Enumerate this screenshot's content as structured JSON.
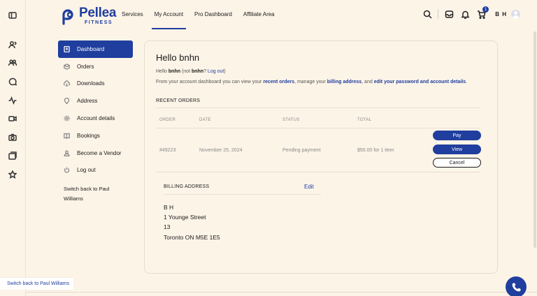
{
  "brand": {
    "name": "Pellea",
    "sub": "FITNESS",
    "color": "#1f3e9e"
  },
  "nav": {
    "services": "Services",
    "my_account": "My Account",
    "pro_dashboard": "Pro Dashboard",
    "affiliate": "Affiliate Area"
  },
  "header": {
    "cart_count": "1",
    "user_initials": "B H"
  },
  "rail_icons": [
    "sidebar-toggle-icon",
    "user-switch-icon",
    "group-icon",
    "chat-icon",
    "activity-icon",
    "video-icon",
    "camera-icon",
    "layers-icon",
    "star-icon"
  ],
  "menu": {
    "items": [
      {
        "label": "Dashboard",
        "icon": "dashboard-icon"
      },
      {
        "label": "Orders",
        "icon": "box-icon"
      },
      {
        "label": "Downloads",
        "icon": "cloud-download-icon"
      },
      {
        "label": "Address",
        "icon": "location-icon"
      },
      {
        "label": "Account details",
        "icon": "gear-icon"
      },
      {
        "label": "Bookings",
        "icon": "book-icon"
      },
      {
        "label": "Become a Vendor",
        "icon": "user-icon"
      },
      {
        "label": "Log out",
        "icon": "power-icon"
      }
    ],
    "switch_back": "Switch back to Paul Williams"
  },
  "main": {
    "title": "Hello bnhn",
    "hello_prefix": "Hello ",
    "hello_name": "bnhn",
    "hello_mid": " (not ",
    "hello_name2": "bnhn",
    "hello_q": "? ",
    "logout_link": "Log out",
    "hello_end": ")",
    "intro_1": "From your account dashboard you can view your ",
    "intro_link1": "recent orders",
    "intro_2": ", manage your ",
    "intro_link2": "billing address",
    "intro_3": ", and ",
    "intro_link3": "edit your password and account details",
    "intro_4": "."
  },
  "recent_orders": {
    "title": "RECENT ORDERS",
    "columns": [
      "ORDER",
      "DATE",
      "STATUS",
      "TOTAL"
    ],
    "row": {
      "order": "#49223",
      "date": "November 25, 2024",
      "status": "Pending payment",
      "total": "$50.00 for 1 item"
    },
    "actions": {
      "pay": "Pay",
      "view": "View",
      "cancel": "Cancel"
    }
  },
  "billing": {
    "title": "BILLING ADDRESS",
    "edit": "Edit",
    "lines": [
      "B H",
      "1 Younge Street",
      "13",
      "Toronto ON M5E 1E5"
    ]
  },
  "floating": {
    "switch_back": "Switch back to Paul Williams",
    "phone_icon": "phone-icon"
  }
}
